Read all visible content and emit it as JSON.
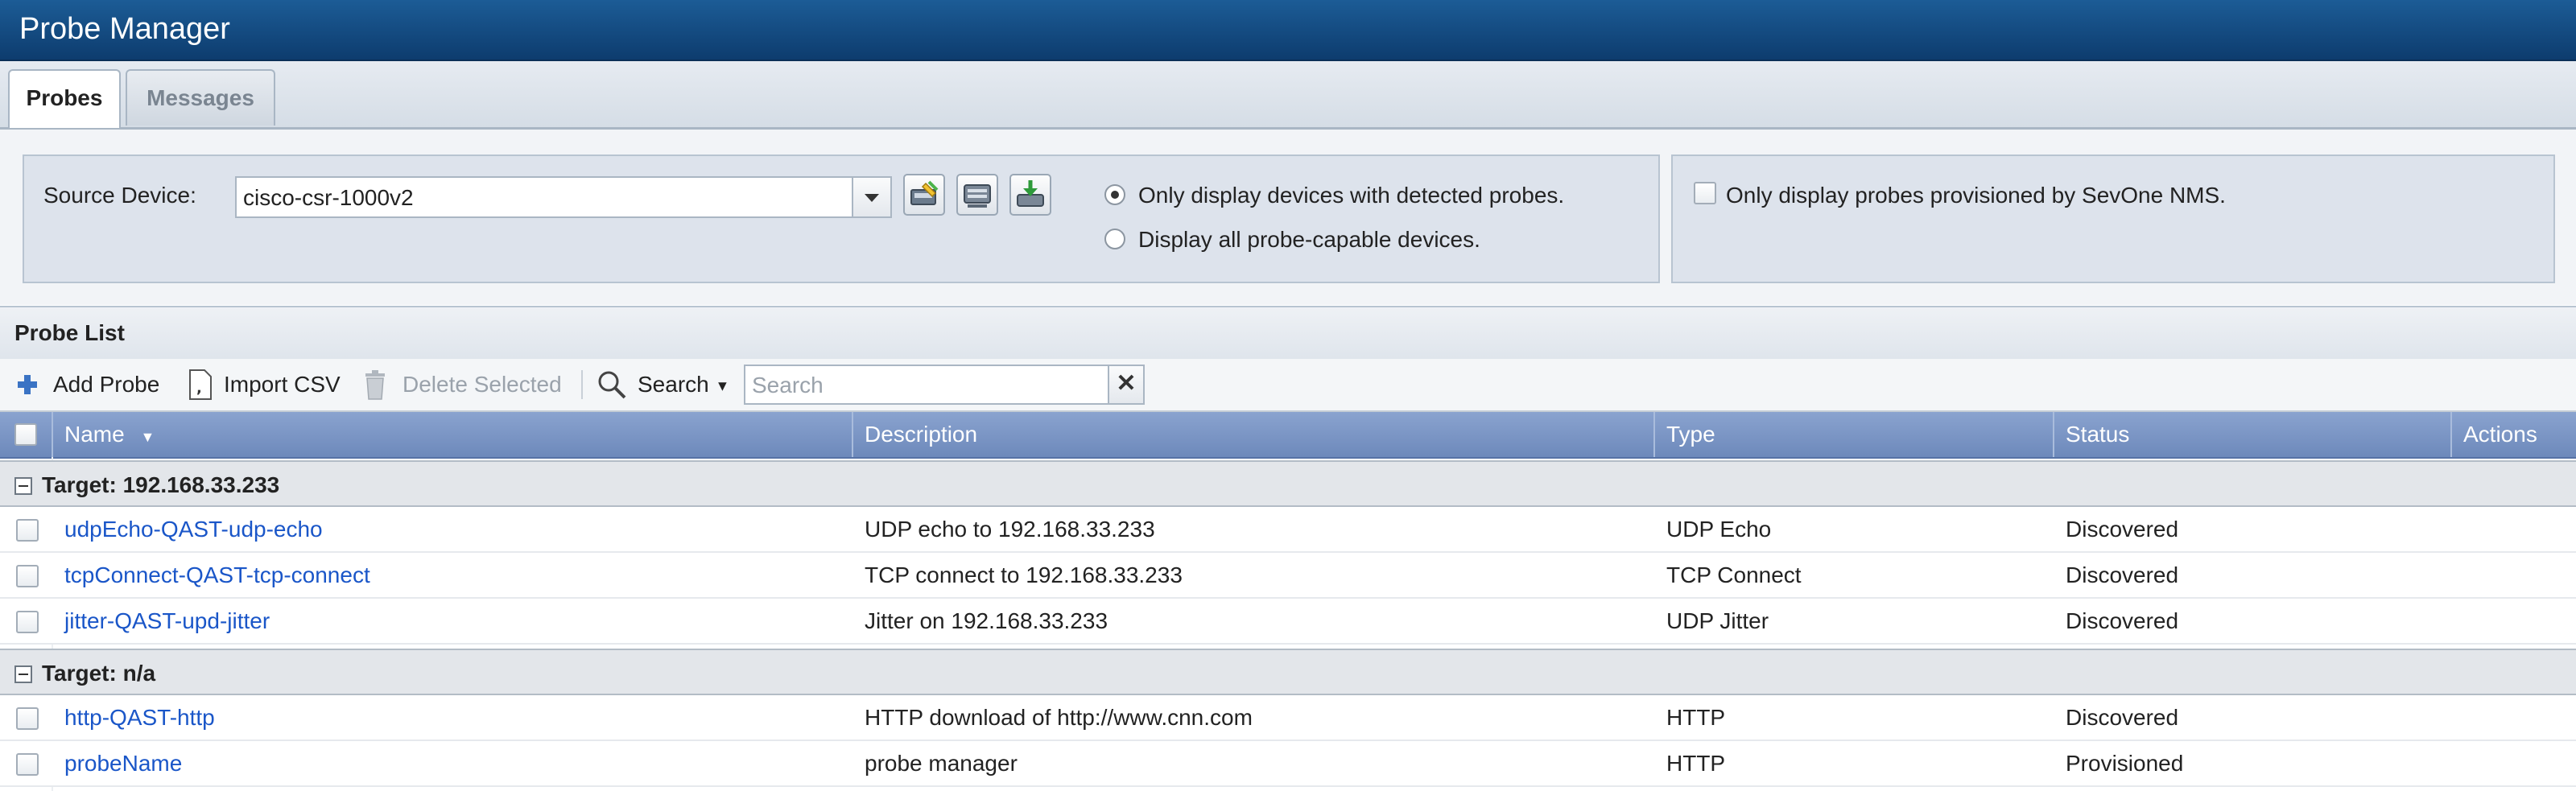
{
  "window": {
    "title": "Probe Manager"
  },
  "tabs": [
    {
      "label": "Probes",
      "active": true
    },
    {
      "label": "Messages",
      "active": false
    }
  ],
  "filters": {
    "source_device_label": "Source Device:",
    "source_device_value": "cisco-csr-1000v2",
    "icon_buttons": [
      "edit-device-icon",
      "device-settings-icon",
      "download-device-icon"
    ],
    "radio_detected": "Only display devices with detected probes.",
    "radio_detected_selected": true,
    "radio_all": "Display all probe-capable devices.",
    "sevone_checkbox": "Only display probes provisioned by SevOne NMS.",
    "sevone_checked": false
  },
  "probe_list": {
    "title": "Probe List",
    "toolbar": {
      "add": "Add Probe",
      "import": "Import CSV",
      "delete": "Delete Selected",
      "search_button": "Search",
      "search_placeholder": "Search",
      "clear": "✕"
    },
    "columns": {
      "name": "Name",
      "description": "Description",
      "type": "Type",
      "status": "Status",
      "actions": "Actions"
    },
    "groups": [
      {
        "title": "Target: 192.168.33.233",
        "rows": [
          {
            "name": "udpEcho-QAST-udp-echo",
            "description": "UDP echo to 192.168.33.233",
            "type": "UDP Echo",
            "status": "Discovered"
          },
          {
            "name": "tcpConnect-QAST-tcp-connect",
            "description": "TCP connect to 192.168.33.233",
            "type": "TCP Connect",
            "status": "Discovered"
          },
          {
            "name": "jitter-QAST-upd-jitter",
            "description": "Jitter on 192.168.33.233",
            "type": "UDP Jitter",
            "status": "Discovered"
          }
        ]
      },
      {
        "title": "Target: n/a",
        "rows": [
          {
            "name": "http-QAST-http",
            "description": "HTTP download of http://www.cnn.com",
            "type": "HTTP",
            "status": "Discovered"
          },
          {
            "name": "probeName",
            "description": "probe manager",
            "type": "HTTP",
            "status": "Provisioned"
          }
        ]
      }
    ]
  },
  "colors": {
    "titlebar": "#0d3c6e",
    "grid_header": "#7b96c6",
    "link": "#1a56c8",
    "add_icon": "#3a73c4"
  }
}
